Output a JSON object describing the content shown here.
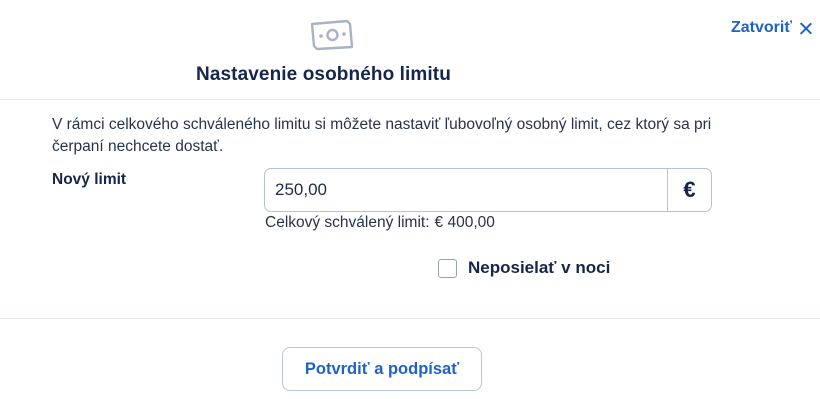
{
  "header": {
    "icon": "money-banknote-icon",
    "title": "Nastavenie osobného limitu",
    "close_label": "Zatvoriť",
    "close_icon": "close-icon"
  },
  "form": {
    "description": "V rámci celkového schváleného limitu si môžete nastaviť ľubovoľný osobný limit, cez ktorý sa pri čerpaní nechcete dostať.",
    "limit_label": "Nový limit",
    "limit_value": "250,00",
    "currency_symbol": "€",
    "hint_label": "Celkový schválený limit:",
    "hint_value": "€ 400,00",
    "checkbox_label": "Neposielať v noci",
    "checkbox_checked": false
  },
  "footer": {
    "confirm_label": "Potvrdiť a podpísať"
  },
  "colors": {
    "accent": "#1f62c8",
    "title": "#17254a",
    "text": "#27334d",
    "border": "#b9c2cf",
    "icon": "#a9b3c2"
  }
}
